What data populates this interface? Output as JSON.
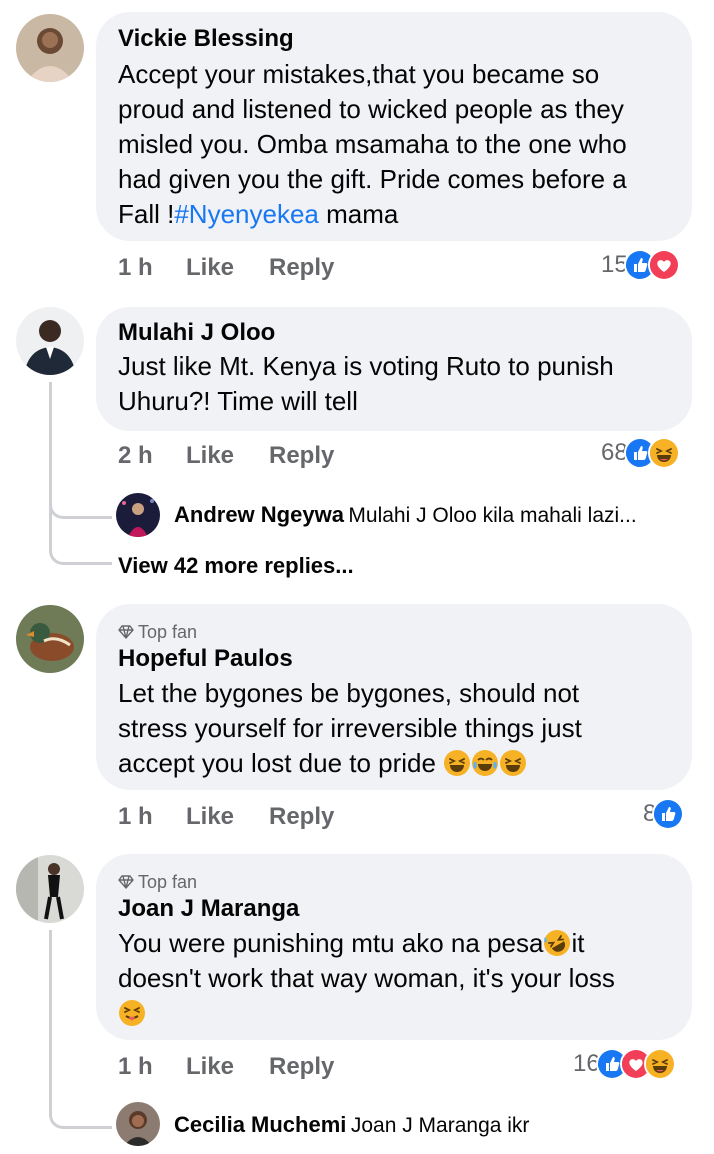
{
  "comments": [
    {
      "author": "Vickie Blessing",
      "text_lines": [
        "Accept your mistakes,that you became so",
        "proud and listened to wicked people as they",
        "misled you. Omba msamaha to the one who",
        "had given you the gift. Pride comes before a"
      ],
      "last_line_pre": "Fall !",
      "hashtag": "#Nyenyekea",
      "last_line_post": " mama",
      "time": "1 h",
      "like": "Like",
      "reply": "Reply",
      "reaction_count": "15",
      "reactions": [
        "like-icon",
        "love-icon"
      ]
    },
    {
      "author": "Mulahi J Oloo",
      "text_lines": [
        "Just like Mt. Kenya is voting Ruto to punish",
        "Uhuru?! Time will tell"
      ],
      "time": "2 h",
      "like": "Like",
      "reply": "Reply",
      "reaction_count": "68",
      "reactions": [
        "like-icon",
        "haha-icon"
      ],
      "reply_preview": {
        "author": "Andrew Ngeywa",
        "text": "Mulahi J Oloo kila mahali lazi..."
      },
      "view_more": "View 42 more replies..."
    },
    {
      "badge": "Top fan",
      "author": "Hopeful Paulos",
      "text_lines": [
        "Let the bygones be bygones, should not",
        "stress yourself for irreversible things just",
        "accept you lost due to pride"
      ],
      "time": "1 h",
      "like": "Like",
      "reply": "Reply",
      "reaction_count": "8",
      "reactions": [
        "like-icon"
      ]
    },
    {
      "badge": "Top fan",
      "author": "Joan J Maranga",
      "text_lines": [
        "You were punishing mtu ako na pesa",
        "it",
        "doesn't work that way woman, it's your loss"
      ],
      "time": "1 h",
      "like": "Like",
      "reply": "Reply",
      "reaction_count": "16",
      "reactions": [
        "like-icon",
        "love-icon",
        "haha-icon"
      ],
      "reply_preview": {
        "author": "Cecilia Muchemi",
        "text": "Joan J Maranga ikr"
      }
    }
  ],
  "colors": {
    "like_blue": "#1877f2",
    "love_red": "#f33e58",
    "haha_yellow": "#f7b125",
    "meta_gray": "#65676b",
    "bubble_bg": "#f0f2f5"
  }
}
